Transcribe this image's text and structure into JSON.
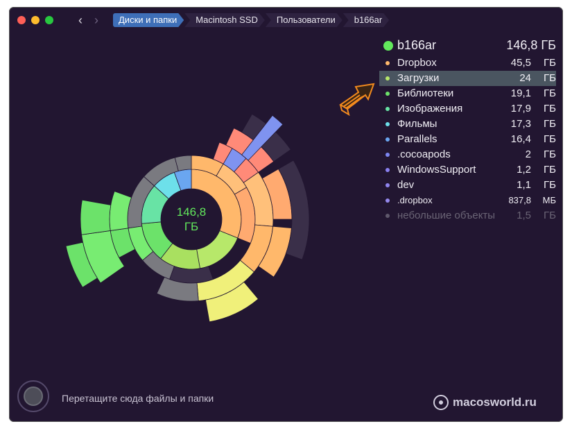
{
  "window": {
    "traffic_lights": {
      "close": "#ff5f57",
      "minimize": "#febc2e",
      "zoom": "#28c840"
    }
  },
  "nav": {
    "back_glyph": "‹",
    "forward_glyph": "›"
  },
  "breadcrumb": [
    {
      "label": "Диски и папки",
      "active": true
    },
    {
      "label": "Macintosh SSD",
      "active": false
    },
    {
      "label": "Пользователи",
      "active": false
    },
    {
      "label": "b166ar",
      "active": false
    }
  ],
  "center": {
    "size_value": "146,8",
    "size_unit": "ГБ"
  },
  "legend": {
    "header": {
      "name": "b166ar",
      "size": "146,8 ГБ",
      "color": "#62e85c"
    },
    "items": [
      {
        "name": "Dropbox",
        "value": "45,5",
        "unit": "ГБ",
        "color": "#ffb86b",
        "selected": false
      },
      {
        "name": "Загрузки",
        "value": "24",
        "unit": "ГБ",
        "color": "#b7e86a",
        "selected": true
      },
      {
        "name": "Библиотеки",
        "value": "19,1",
        "unit": "ГБ",
        "color": "#6ce26a",
        "selected": false
      },
      {
        "name": "Изображения",
        "value": "17,9",
        "unit": "ГБ",
        "color": "#68e3a5",
        "selected": false
      },
      {
        "name": "Фильмы",
        "value": "17,3",
        "unit": "ГБ",
        "color": "#6de0ea",
        "selected": false
      },
      {
        "name": "Parallels",
        "value": "16,4",
        "unit": "ГБ",
        "color": "#6aa6f0",
        "selected": false
      },
      {
        "name": ".cocoapods",
        "value": "2",
        "unit": "ГБ",
        "color": "#7d86f2",
        "selected": false
      },
      {
        "name": "WindowsSupport",
        "value": "1,2",
        "unit": "ГБ",
        "color": "#8a80f0",
        "selected": false
      },
      {
        "name": "dev",
        "value": "1,1",
        "unit": "ГБ",
        "color": "#8f84ee",
        "selected": false
      },
      {
        "name": ".dropbox",
        "value": "837,8",
        "unit": "МБ",
        "color": "#9488ec",
        "selected": false,
        "small": true
      },
      {
        "name": "небольшие объекты",
        "value": "1,5",
        "unit": "ГБ",
        "color": "#5f586c",
        "selected": false,
        "dim": true
      }
    ]
  },
  "footer": {
    "hint": "Перетащите сюда файлы и папки"
  },
  "watermark": {
    "text": "macosworld.ru"
  }
}
